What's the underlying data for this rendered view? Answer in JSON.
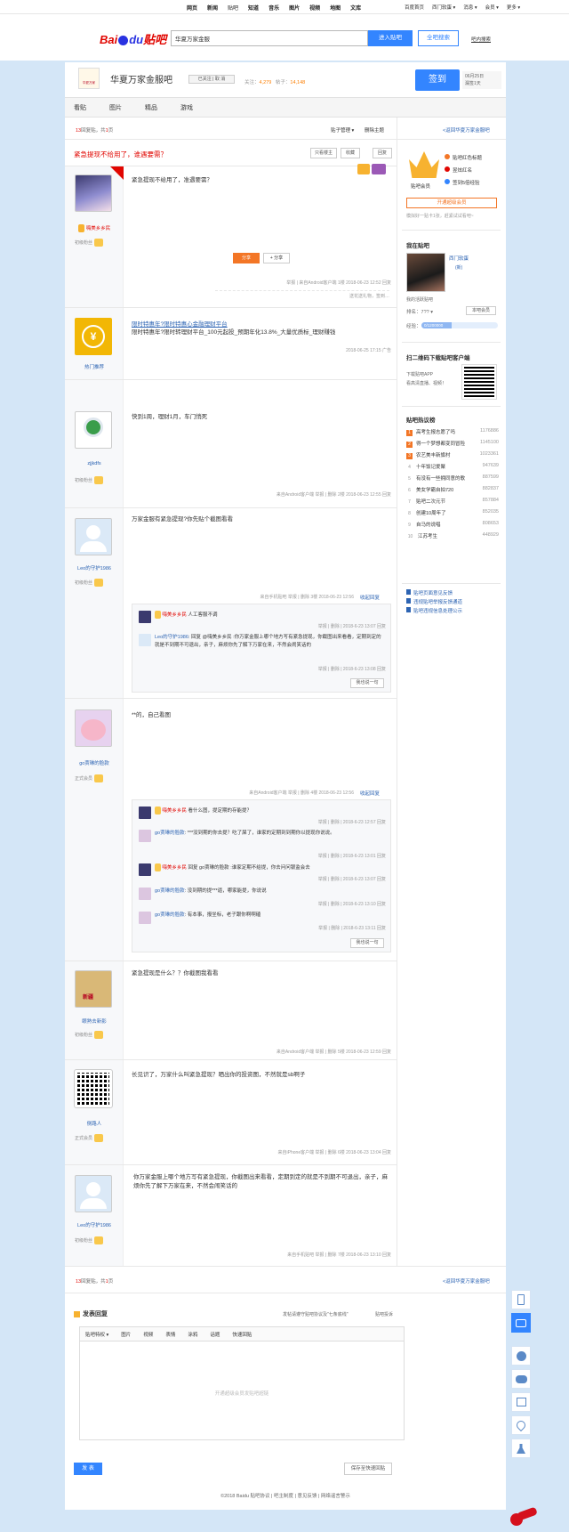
{
  "topnav": [
    "网页",
    "新闻",
    "贴吧",
    "知道",
    "音乐",
    "图片",
    "视频",
    "地图",
    "文库"
  ],
  "topright": {
    "home": "百度首页",
    "user": "西门软蛋 ▾",
    "msg": "消息 ▾",
    "member": "会员 ▾",
    "more": "更多 ▾"
  },
  "header": {
    "logo_bai": "Bai",
    "logo_du": "du",
    "logo_tieba": "贴吧",
    "search_value": "华夏万家金服",
    "enter_btn": "进入贴吧",
    "search_btn": "全吧搜索",
    "advanced": "吧内搜索"
  },
  "forum": {
    "name": "华夏万家金服吧",
    "follow": "已关注",
    "cancel": "取 消",
    "followers_label": "关注：",
    "followers": "4,279",
    "posts_label": "帖子：",
    "posts": "14,148",
    "sign_btn": "签到",
    "sign_date": "06月25日",
    "sign_note": "漏签1天",
    "logo_text": "华夏万家"
  },
  "tabs": [
    "看贴",
    "图片",
    "精品",
    "游戏"
  ],
  "pager": {
    "count_a": "13",
    "label_a": "回复贴，共",
    "count_b": "1",
    "label_b": "页",
    "order": "贴子管理 ▾",
    "delete": "删除主题",
    "back": "<返回华夏万家金服吧"
  },
  "thread": {
    "title": "紧急提现不给用了，谁遇要需？",
    "only_lz": "只看楼主",
    "collect": "收藏",
    "reply": "回复"
  },
  "floors": [
    {
      "user": "嗨美乡乡民",
      "level": "初级粉丝",
      "content": "紧急提现不给用了，准遇要需？",
      "share1": "分享",
      "meta": "举报 | 来自Android客户端   1楼   2018-06-23 12:52   回复",
      "like": "送花送礼物，签到…"
    },
    {
      "user": "热门推荐",
      "title": "限时特惠年?限时特惠心金融理财平台",
      "content": "限时特惠年?限时转理财平台_100元起投_预期年化13.8%_大量优质标_理财赚钱",
      "meta": "2018-06-25 17:15  广告"
    },
    {
      "user": "zjjkdfs",
      "level": "初级粉丝",
      "content": "快到1周，理财1月，车门悄死",
      "meta": "来自Android客户端   举报 | 删除   2楼   2018-06-23 12:55   回复"
    },
    {
      "user": "Leo的守护1986",
      "level": "初级粉丝",
      "content": "万家金服有紧急提现?你先贴个截图看看",
      "meta": "来自手机贴吧   举报 | 删除   3楼   2018-06-23 12:56",
      "collapse": "收起回复",
      "replies": [
        {
          "user": "嗨美乡乡民",
          "text": "人工客服不调",
          "meta": "举报 | 删除 | 2018-6-23 13:07  回复"
        },
        {
          "user": "Leo的守护1986",
          "text": "回复 @嗨美乡乡民 :你万家金服上哪个地方写有紧急提现，你截图出来看看，定期到定的就是不到期不可退出，亲子，麻烦你先了解下万家在来，不然会闹笑话的",
          "meta": "举报 | 删除 | 2018-6-23 13:08  回复"
        }
      ],
      "more": "我也说一句"
    },
    {
      "user": "go贾琳的脸款",
      "level": "正式会员",
      "content": "**的，自己看图",
      "meta": "来自Android客户端   举报 | 删除   4楼   2018-06-23 12:56",
      "collapse": "收起回复",
      "replies": [
        {
          "user": "嗨美乡乡民",
          "text": "看什么图，提定期的存能提？",
          "meta": "举报 | 删除 | 2018-6-23 12:57  回复"
        },
        {
          "user": "go贾琳的脸款",
          "text": "***没到期的你去提？吃了屎了，谁家的定期到到期你以提现你说说。",
          "meta": "举报 | 删除 | 2018-6-23 13:01  回复"
        },
        {
          "user": "嗨美乡乡民",
          "text": "回复 go贾琳的脸款 :谁家定期不给提，你去问问银监会去",
          "meta": "举报 | 删除 | 2018-6-23 13:07  回复"
        },
        {
          "user": "go贾琳的脸款",
          "text": "没到期的提***逼，哪家能提，你说说",
          "meta": "举报 | 删除 | 2018-6-23 13:10  回复"
        },
        {
          "user": "go贾琳的脸款",
          "text": "有本事，报坐标，老子跟你啊啊磕",
          "meta": "举报 | 删除 | 2018-6-23 13:11  回复"
        }
      ],
      "more": "我也说一句"
    },
    {
      "user": "眼熟去新影",
      "level": "初级粉丝",
      "content": "紧急提现是什么？？你截图我看看",
      "meta": "来自Android客户端   举报 | 删除   5楼   2018-06-23 12:59   回复"
    },
    {
      "user": "侧路人",
      "level": "正式会员",
      "content": "长见识了，万家什么叫紧急提现？晒出你的投资图，不然就是sb啊子",
      "meta": "来自iPhone客户端   举报 | 删除   6楼   2018-06-23 13:04   回复"
    },
    {
      "user": "Leo的守护1986",
      "level": "初级粉丝",
      "content": "你万家金服上哪个地方写有紧急提现，你截图出来看看，定期到定的就是不到期不可退出，亲子，麻烦你先了解下万家在来，不然会闹笑话的",
      "meta": "来自手机贴吧   举报 | 删除   7楼   2018-06-23 13:10   回复"
    }
  ],
  "sidebar": {
    "vip": [
      "贴吧红色标题",
      "昱炫红名",
      "签到5倍经验"
    ],
    "vip_title": "贴吧会员",
    "vip_btn": "开通超级会员",
    "vip_note": "模拟好一贴卡1张，赶紧试试看吧~",
    "my_title": "我在贴吧",
    "my_user": "西门软蛋",
    "my_tag": "(新)",
    "my_note": "我的活跃贴吧",
    "rank_label": "排名：",
    "rank": "7?? ▾",
    "rank_btn": "本吧会员",
    "exp_label": "经验：",
    "exp": "0/1200000",
    "app_title": "扫二维码下载贴吧客户端",
    "app_note1": "下载贴吧APP",
    "app_note2": "看高清直播、视频！",
    "hot_title": "贴吧热议榜",
    "hot": [
      [
        "高考生报志愿了吗",
        "1176886"
      ],
      [
        "得一个梦想都变同冒险",
        "1145100"
      ],
      [
        "农艺美丰新旗村",
        "1023361"
      ],
      [
        "十年饭记爱聚",
        "947639"
      ],
      [
        "有没有一些拥同意的歌",
        "887599"
      ],
      [
        "美女学霸自拍720",
        "882837"
      ],
      [
        "贴吧二次元节",
        "857884"
      ],
      [
        "创建10周年了",
        "852035"
      ],
      [
        "自马的说唱",
        "808653"
      ],
      [
        "江苏考生",
        "448929"
      ]
    ],
    "links": [
      "贴吧页面意见反馈",
      "违规贴吧举报反馈通道",
      "贴吧违规信息处理公示"
    ]
  },
  "bottom_pager": {
    "count_a": "13",
    "label_a": "回复贴，共",
    "count_b": "1",
    "label_b": "页",
    "back": "<返回华夏万家金服吧"
  },
  "reply_box": {
    "title": "发表回复",
    "rule": "发帖请遵守贴吧协议及\"七条底线\"",
    "rule2": "贴吧投诉",
    "tools": [
      "贴吧特权 ▾",
      "图片",
      "视频",
      "表情",
      "涂鸦",
      "话题",
      "快速回贴"
    ],
    "placeholder": "开通超级会员发贴吧超链",
    "submit": "发 表",
    "save": "保存至快速回贴"
  },
  "footer": {
    "text": "©2018 Baidu 贴吧协议 | 吧主制度 | 意见反馈 | 网络谣言警示"
  }
}
